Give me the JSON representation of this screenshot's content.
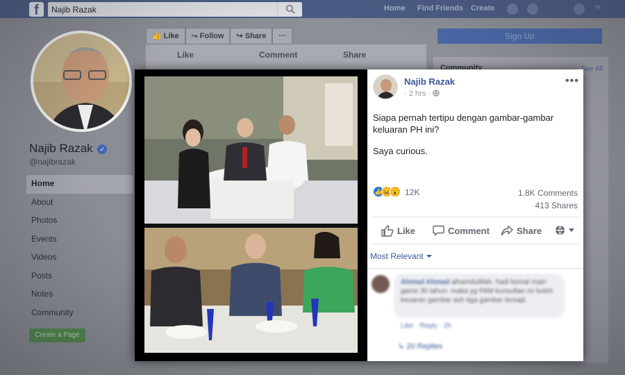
{
  "topbar": {
    "logo": "f",
    "search_value": "Najib Razak",
    "links": [
      "Home",
      "Find Friends",
      "Create"
    ]
  },
  "profile": {
    "name": "Najib Razak",
    "handle": "@najibrazak",
    "nav": [
      "Home",
      "About",
      "Photos",
      "Events",
      "Videos",
      "Posts",
      "Notes",
      "Community"
    ],
    "create_page": "Create a Page"
  },
  "bg_page": {
    "action_buttons": [
      "Like",
      "Follow",
      "Share",
      "···"
    ],
    "post_actions": [
      "Like",
      "Comment",
      "Share"
    ],
    "signup": "Sign Up",
    "community_title": "Community",
    "see_all": "See All"
  },
  "post": {
    "author": "Najib Razak",
    "time": "2 hrs",
    "more": "•••",
    "text_line1": "Siapa pernah tertipu dengan gambar-gambar keluaran PH ini?",
    "text_line2": "Saya curious.",
    "reaction_count": "12K",
    "comments": "1.8K Comments",
    "shares": "413 Shares",
    "actions": {
      "like": "Like",
      "comment": "Comment",
      "share": "Share"
    },
    "sort": "Most Relevant"
  },
  "comment": {
    "author": "Ahmad Ahmad",
    "text": "alhamdulillah. hadi kemal main game 30 tahun. maka yg PAM kunsultan ini boleh keuaran gambar ash tiga gambar tersajil.",
    "links": "Like · Reply · 2h",
    "replies": "20 Replies"
  },
  "colors": {
    "brand": "#4267b2",
    "link": "#385898",
    "muted": "#606770"
  }
}
